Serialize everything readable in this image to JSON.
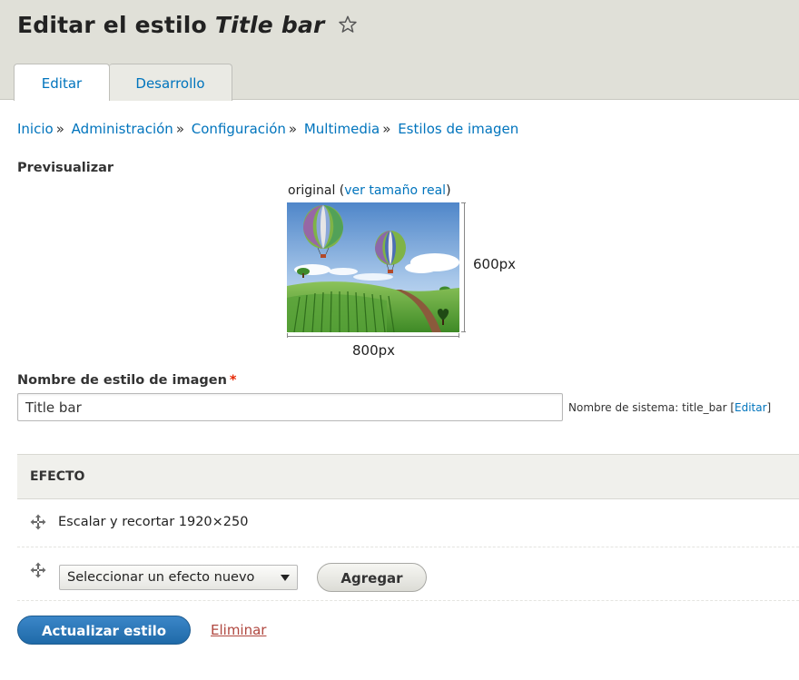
{
  "header": {
    "title_prefix": "Editar el estilo",
    "title_style_name": "Title bar",
    "tabs": [
      {
        "label": "Editar",
        "active": true
      },
      {
        "label": "Desarrollo",
        "active": false
      }
    ]
  },
  "breadcrumb": {
    "items": [
      "Inicio",
      "Administración",
      "Configuración",
      "Multimedia",
      "Estilos de imagen"
    ],
    "separator": "»"
  },
  "preview": {
    "label": "Previsualizar",
    "caption_prefix": "original (",
    "caption_link": "ver tamaño real",
    "caption_suffix": ")",
    "height_label": "600px",
    "width_label": "800px"
  },
  "name_field": {
    "label": "Nombre de estilo de imagen",
    "required_mark": "*",
    "value": "Title bar",
    "machine_name_prefix": "Nombre de sistema: title_bar [",
    "machine_name_link": "Editar",
    "machine_name_suffix": "]"
  },
  "effects": {
    "header": "EFECTO",
    "rows": [
      {
        "label": "Escalar y recortar 1920×250"
      }
    ],
    "new_effect_select": "Seleccionar un efecto nuevo",
    "add_button": "Agregar"
  },
  "actions": {
    "submit": "Actualizar estilo",
    "delete": "Eliminar"
  },
  "colors": {
    "link": "#0074bd",
    "header_bg": "#e0e0d8",
    "primary_button": "#2a76b8",
    "delete_link": "#b0473f",
    "required": "#e62600"
  },
  "icons": {
    "favorite": "star-outline-icon",
    "drag": "move-arrows-icon",
    "dropdown": "triangle-down-icon"
  }
}
